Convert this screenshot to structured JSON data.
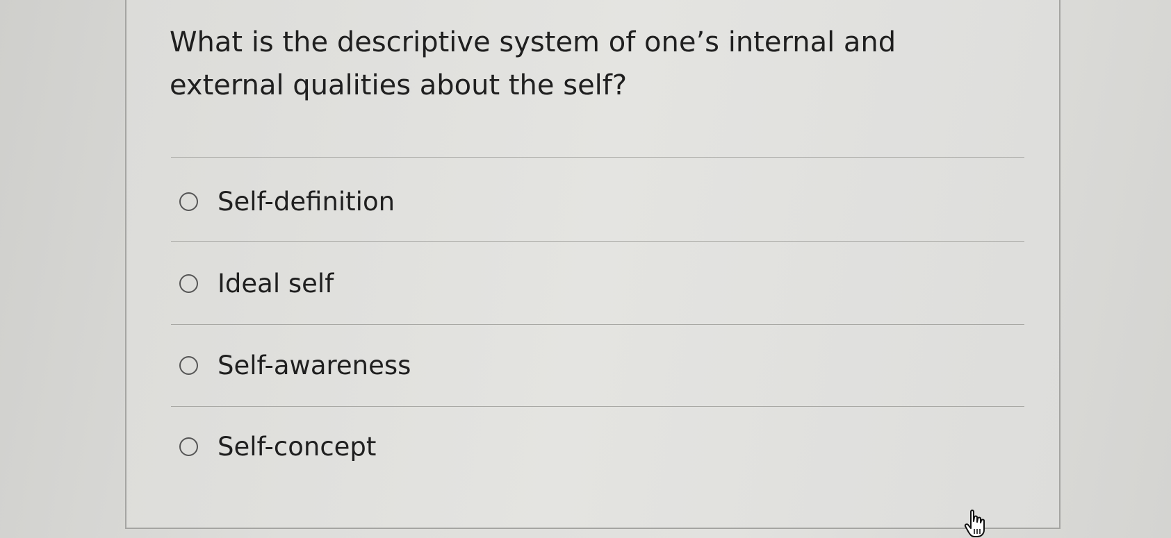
{
  "question": {
    "text": "What is the descriptive system of one’s internal and external qualities about the self?"
  },
  "options": [
    {
      "label": "Self-definition",
      "selected": false
    },
    {
      "label": "Ideal self",
      "selected": false
    },
    {
      "label": "Self-awareness",
      "selected": false
    },
    {
      "label": "Self-concept",
      "selected": false
    }
  ],
  "cursor": {
    "icon": "hand-pointer-icon"
  }
}
